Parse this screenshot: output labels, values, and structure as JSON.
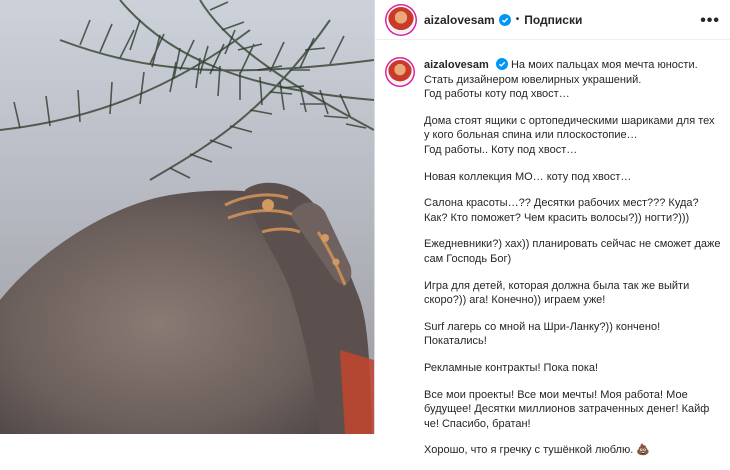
{
  "post": {
    "username": "aizalovesam",
    "separator": "•",
    "follow_label": "Подписки",
    "more_label": "•••",
    "caption": {
      "lead": "На моих пальцах моя мечта юности.",
      "paragraphs": [
        "Стать дизайнером ювелирных украшений.\nГод работы коту под хвост…",
        "Дома стоят ящики с ортопедическими шариками для тех у кого больная спина или плоскостопие…\nГод работы.. Коту под хвост…",
        "Новая коллекция МО… коту под хвост…",
        "Салона красоты…?? Десятки рабочих мест??? Куда? Как? Кто поможет? Чем красить волосы?)) ногти?)))",
        "Ежедневники?) хах)) планировать сейчас не сможет даже сам Господь Бог)",
        "Игра для детей, которая должна была так же выйти скоро?)) ага! Конечно)) играем уже!",
        "Surf лагерь со мной на Шри-Ланку?)) кончено! Покатались!",
        "Рекламные контракты! Пока пока!",
        "Все мои проекты! Все мои мечты! Моя работа! Мое будущее! Десятки миллионов затраченных денег! Кайф че! Спасибо, братан!",
        "Хорошо, что я гречку с тушёнкой люблю. 💩"
      ]
    }
  },
  "icons": {
    "verified": "verified-badge-icon",
    "more": "more-options-icon"
  },
  "colors": {
    "verified": "#0095f6",
    "story_ring": "#d6249f",
    "text": "#262626"
  }
}
